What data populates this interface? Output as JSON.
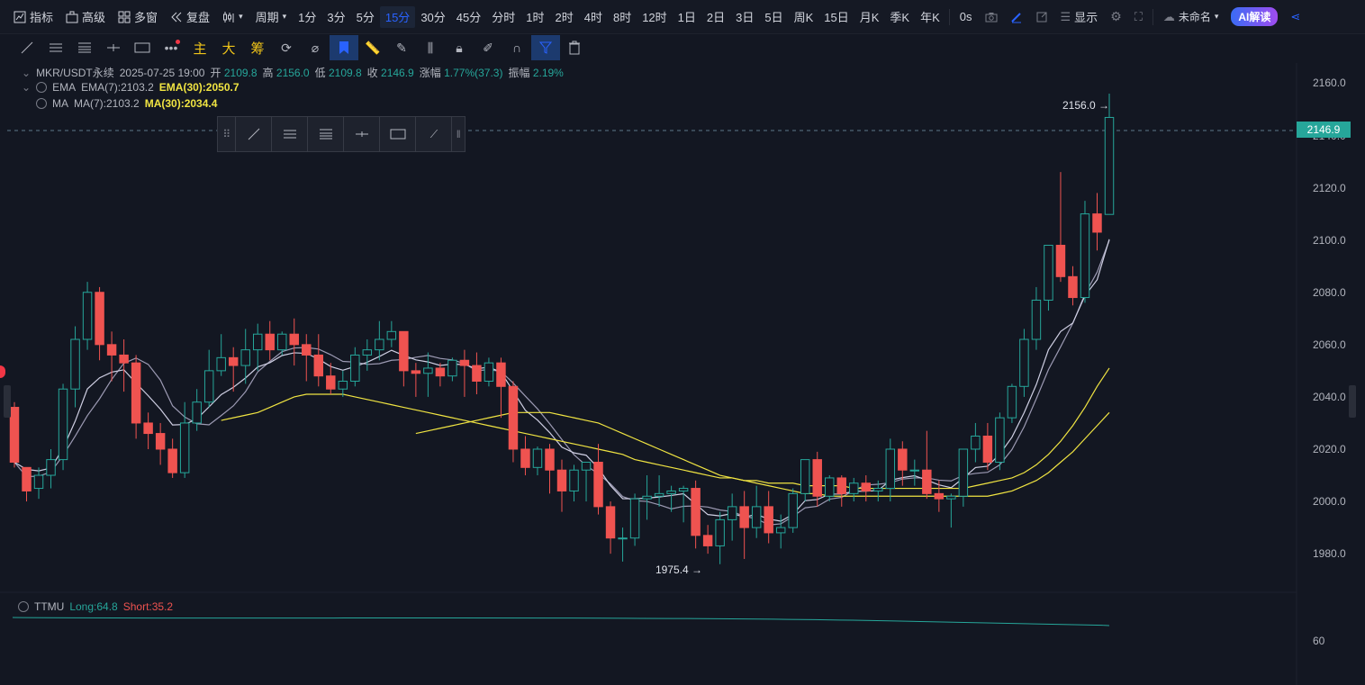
{
  "topbar": {
    "indicators": "指标",
    "advanced": "高级",
    "multi_window": "多窗",
    "replay": "复盘",
    "period": "周期",
    "periods": [
      "1分",
      "3分",
      "5分",
      "15分",
      "30分",
      "45分",
      "分时",
      "1时",
      "2时",
      "4时",
      "8时",
      "12时",
      "1日",
      "2日",
      "3日",
      "5日",
      "周K",
      "15日",
      "月K",
      "季K",
      "年K"
    ],
    "active_period": "15分",
    "countdown": "0s",
    "display": "显示",
    "unnamed": "未命名",
    "ai_button": "AI解读"
  },
  "toolbar2": {
    "main": "主",
    "big": "大",
    "chips": "筹"
  },
  "legend": {
    "symbol": "MKR/USDT永续",
    "datetime": "2025-07-25 19:00",
    "open_label": "开",
    "open": "2109.8",
    "high_label": "高",
    "high": "2156.0",
    "low_label": "低",
    "low": "2109.8",
    "close_label": "收",
    "close": "2146.9",
    "change_label": "涨幅",
    "change": "1.77%(37.3)",
    "amp_label": "振幅",
    "amp": "2.19%",
    "ema_name": "EMA",
    "ema7": "EMA(7):2103.2",
    "ema30": "EMA(30):2050.7",
    "ma_name": "MA",
    "ma7": "MA(7):2103.2",
    "ma30": "MA(30):2034.4"
  },
  "price_axis": [
    "2160.0",
    "2140.0",
    "2120.0",
    "2100.0",
    "2080.0",
    "2060.0",
    "2040.0",
    "2020.0",
    "2000.0",
    "1980.0"
  ],
  "last_price": "2146.9",
  "high_marker": "2156.0 →",
  "low_marker": "1975.4 →",
  "ttmu": {
    "name": "TTMU",
    "long": "Long:64.8",
    "short": "Short:35.2",
    "axis": "60"
  },
  "colors": {
    "up": "#26a69a",
    "down": "#ef5350",
    "bg": "#131722",
    "ema30": "#f0e442",
    "ma30": "#f0e442",
    "ma7": "#9c9ab3",
    "ema7": "#cfcfe3"
  },
  "chart_data": {
    "type": "candlestick",
    "ylim": [
      1968,
      2166
    ],
    "candles": [
      [
        2036,
        2038,
        2015,
        2013
      ],
      [
        2013,
        2013,
        2004,
        2000
      ],
      [
        2005,
        2013,
        2010,
        2001
      ],
      [
        2010,
        2020,
        2016,
        2005
      ],
      [
        2016,
        2045,
        2043,
        2012
      ],
      [
        2043,
        2067,
        2062,
        2036
      ],
      [
        2062,
        2084,
        2080,
        2058
      ],
      [
        2080,
        2082,
        2060,
        2054
      ],
      [
        2060,
        2065,
        2056,
        2046
      ],
      [
        2056,
        2062,
        2053,
        2042
      ],
      [
        2053,
        2056,
        2030,
        2024
      ],
      [
        2030,
        2034,
        2026,
        2020
      ],
      [
        2026,
        2030,
        2020,
        2014
      ],
      [
        2020,
        2024,
        2011,
        2009
      ],
      [
        2011,
        2038,
        2030,
        2009
      ],
      [
        2030,
        2043,
        2038,
        2027
      ],
      [
        2038,
        2058,
        2050,
        2036
      ],
      [
        2050,
        2064,
        2055,
        2048
      ],
      [
        2055,
        2059,
        2052,
        2042
      ],
      [
        2052,
        2066,
        2058,
        2045
      ],
      [
        2058,
        2068,
        2064,
        2050
      ],
      [
        2064,
        2069,
        2058,
        2054
      ],
      [
        2058,
        2065,
        2064,
        2056
      ],
      [
        2064,
        2070,
        2060,
        2052
      ],
      [
        2060,
        2064,
        2056,
        2046
      ],
      [
        2056,
        2064,
        2048,
        2044
      ],
      [
        2048,
        2053,
        2043,
        2041
      ],
      [
        2043,
        2050,
        2046,
        2040
      ],
      [
        2046,
        2059,
        2056,
        2044
      ],
      [
        2056,
        2062,
        2058,
        2050
      ],
      [
        2058,
        2069,
        2062,
        2054
      ],
      [
        2062,
        2069,
        2065,
        2059
      ],
      [
        2065,
        2065,
        2050,
        2044
      ],
      [
        2050,
        2053,
        2049,
        2040
      ],
      [
        2049,
        2057,
        2051,
        2040
      ],
      [
        2051,
        2053,
        2048,
        2044
      ],
      [
        2048,
        2055,
        2054,
        2046
      ],
      [
        2054,
        2058,
        2052,
        2040
      ],
      [
        2052,
        2057,
        2046,
        2041
      ],
      [
        2046,
        2055,
        2053,
        2044
      ],
      [
        2053,
        2055,
        2044,
        2032
      ],
      [
        2044,
        2046,
        2020,
        2015
      ],
      [
        2020,
        2025,
        2013,
        2010
      ],
      [
        2013,
        2021,
        2020,
        2010
      ],
      [
        2020,
        2022,
        2012,
        2003
      ],
      [
        2012,
        2016,
        2004,
        1996
      ],
      [
        2004,
        2014,
        2012,
        2000
      ],
      [
        2012,
        2015,
        2015,
        2000
      ],
      [
        2015,
        2022,
        1998,
        1995
      ],
      [
        1998,
        2000,
        1986,
        1980
      ],
      [
        1986,
        1990,
        1986,
        1977
      ],
      [
        1986,
        2003,
        2001,
        1983
      ],
      [
        2001,
        2010,
        2002,
        1993
      ],
      [
        2002,
        2010,
        2003,
        1998
      ],
      [
        2003,
        2006,
        2004,
        1996
      ],
      [
        2004,
        2006,
        2005,
        1992
      ],
      [
        2005,
        2008,
        1987,
        1982
      ],
      [
        1987,
        1991,
        1983,
        1980
      ],
      [
        1983,
        1996,
        1993,
        1976
      ],
      [
        1993,
        2003,
        1998,
        1985
      ],
      [
        1998,
        2004,
        1990,
        1978
      ],
      [
        1990,
        2006,
        1998,
        1986
      ],
      [
        1998,
        2004,
        1988,
        1984
      ],
      [
        1988,
        1995,
        1990,
        1982
      ],
      [
        1990,
        2005,
        2003,
        1988
      ],
      [
        2003,
        2015,
        2016,
        2000
      ],
      [
        2016,
        2019,
        2002,
        1998
      ],
      [
        2002,
        2010,
        2009,
        2000
      ],
      [
        2009,
        2010,
        2003,
        1998
      ],
      [
        2003,
        2009,
        2007,
        2000
      ],
      [
        2007,
        2010,
        2004,
        2000
      ],
      [
        2004,
        2008,
        2005,
        2000
      ],
      [
        2005,
        2024,
        2020,
        2000
      ],
      [
        2020,
        2023,
        2012,
        2006
      ],
      [
        2012,
        2016,
        2012,
        2006
      ],
      [
        2012,
        2027,
        2003,
        2001
      ],
      [
        2003,
        2008,
        2001,
        1996
      ],
      [
        2001,
        2003,
        2002,
        1990
      ],
      [
        2002,
        2013,
        2020,
        1998
      ],
      [
        2020,
        2030,
        2025,
        2015
      ],
      [
        2025,
        2030,
        2015,
        2012
      ],
      [
        2015,
        2034,
        2032,
        2012
      ],
      [
        2032,
        2045,
        2044,
        2030
      ],
      [
        2044,
        2066,
        2062,
        2040
      ],
      [
        2062,
        2082,
        2077,
        2058
      ],
      [
        2077,
        2098,
        2098,
        2073
      ],
      [
        2098,
        2126,
        2086,
        2084
      ],
      [
        2086,
        2090,
        2078,
        2075
      ],
      [
        2078,
        2115,
        2110,
        2076
      ],
      [
        2110,
        2118,
        2103,
        2096
      ],
      [
        2109.8,
        2156.0,
        2146.9,
        2109.8
      ]
    ],
    "ema30": [
      2031,
      2032,
      2033,
      2034,
      2036,
      2038,
      2040,
      2041,
      2041,
      2041,
      2041,
      2040,
      2039,
      2038,
      2037,
      2036,
      2035,
      2034,
      2033,
      2032,
      2031,
      2030,
      2029,
      2028,
      2027,
      2026,
      2025,
      2024,
      2023,
      2022,
      2021,
      2020,
      2019,
      2018,
      2016,
      2015,
      2014,
      2013,
      2012,
      2011,
      2010,
      2009,
      2009,
      2008,
      2008,
      2007,
      2007,
      2007,
      2006,
      2006,
      2006,
      2006,
      2005,
      2005,
      2005,
      2005,
      2005,
      2005,
      2005,
      2005,
      2005,
      2005,
      2006,
      2007,
      2008,
      2009,
      2011,
      2014,
      2018,
      2023,
      2029,
      2036,
      2044,
      2051
    ],
    "ma30": [
      2026,
      2027,
      2028,
      2029,
      2030,
      2031,
      2032,
      2033,
      2034,
      2034,
      2034,
      2034,
      2033,
      2032,
      2031,
      2030,
      2028,
      2026,
      2024,
      2022,
      2020,
      2018,
      2016,
      2014,
      2012,
      2010,
      2009,
      2008,
      2007,
      2006,
      2005,
      2004,
      2003,
      2003,
      2002,
      2002,
      2002,
      2002,
      2002,
      2002,
      2002,
      2002,
      2002,
      2002,
      2002,
      2002,
      2002,
      2002,
      2003,
      2004,
      2006,
      2008,
      2011,
      2015,
      2019,
      2024,
      2029,
      2034
    ]
  }
}
